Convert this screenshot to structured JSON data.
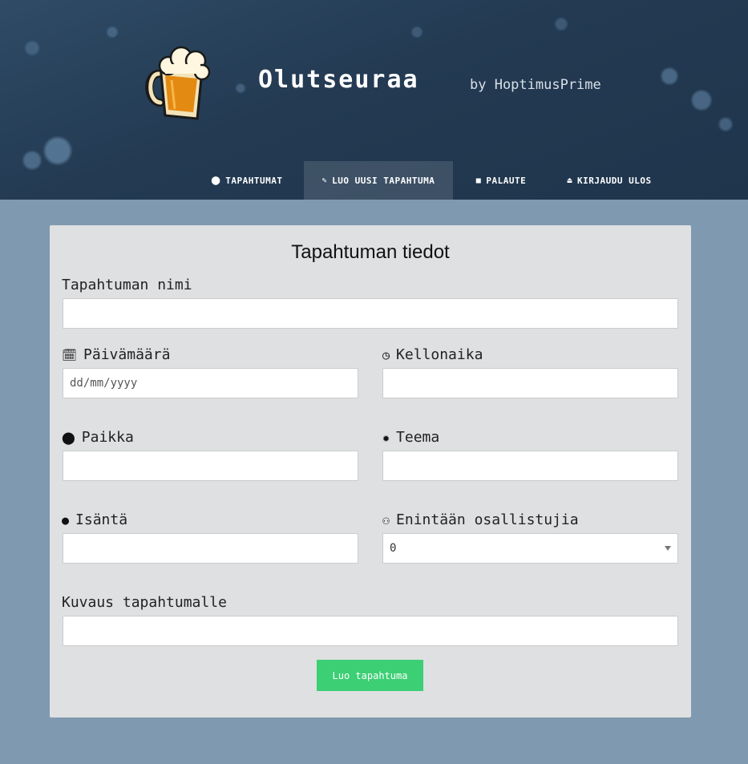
{
  "header": {
    "title": "Olutseuraa",
    "byline": "by HoptimusPrime",
    "logo_icon": "beer-mug-icon"
  },
  "nav": {
    "items": [
      {
        "label": "TAPAHTUMAT",
        "icon": "map-marker-icon",
        "active": false
      },
      {
        "label": "LUO UUSI TAPAHTUMA",
        "icon": "pencil-icon",
        "active": true
      },
      {
        "label": "PALAUTE",
        "icon": "comments-icon",
        "active": false
      },
      {
        "label": "KIRJAUDU ULOS",
        "icon": "eject-icon",
        "active": false
      }
    ]
  },
  "form": {
    "title": "Tapahtuman tiedot",
    "name_label": "Tapahtuman nimi",
    "date_label": "Päivämäärä",
    "date_placeholder": "dd/mm/yyyy",
    "time_label": "Kellonaika",
    "place_label": "Paikka",
    "theme_label": "Teema",
    "host_label": "Isäntä",
    "max_label": "Enintään osallistujia",
    "max_value": "0",
    "description_label": "Kuvaus tapahtumalle",
    "submit_label": "Luo tapahtuma"
  },
  "colors": {
    "accent": "#3ccf74",
    "background": "#7f9ab0",
    "card": "#dfe0e2"
  }
}
